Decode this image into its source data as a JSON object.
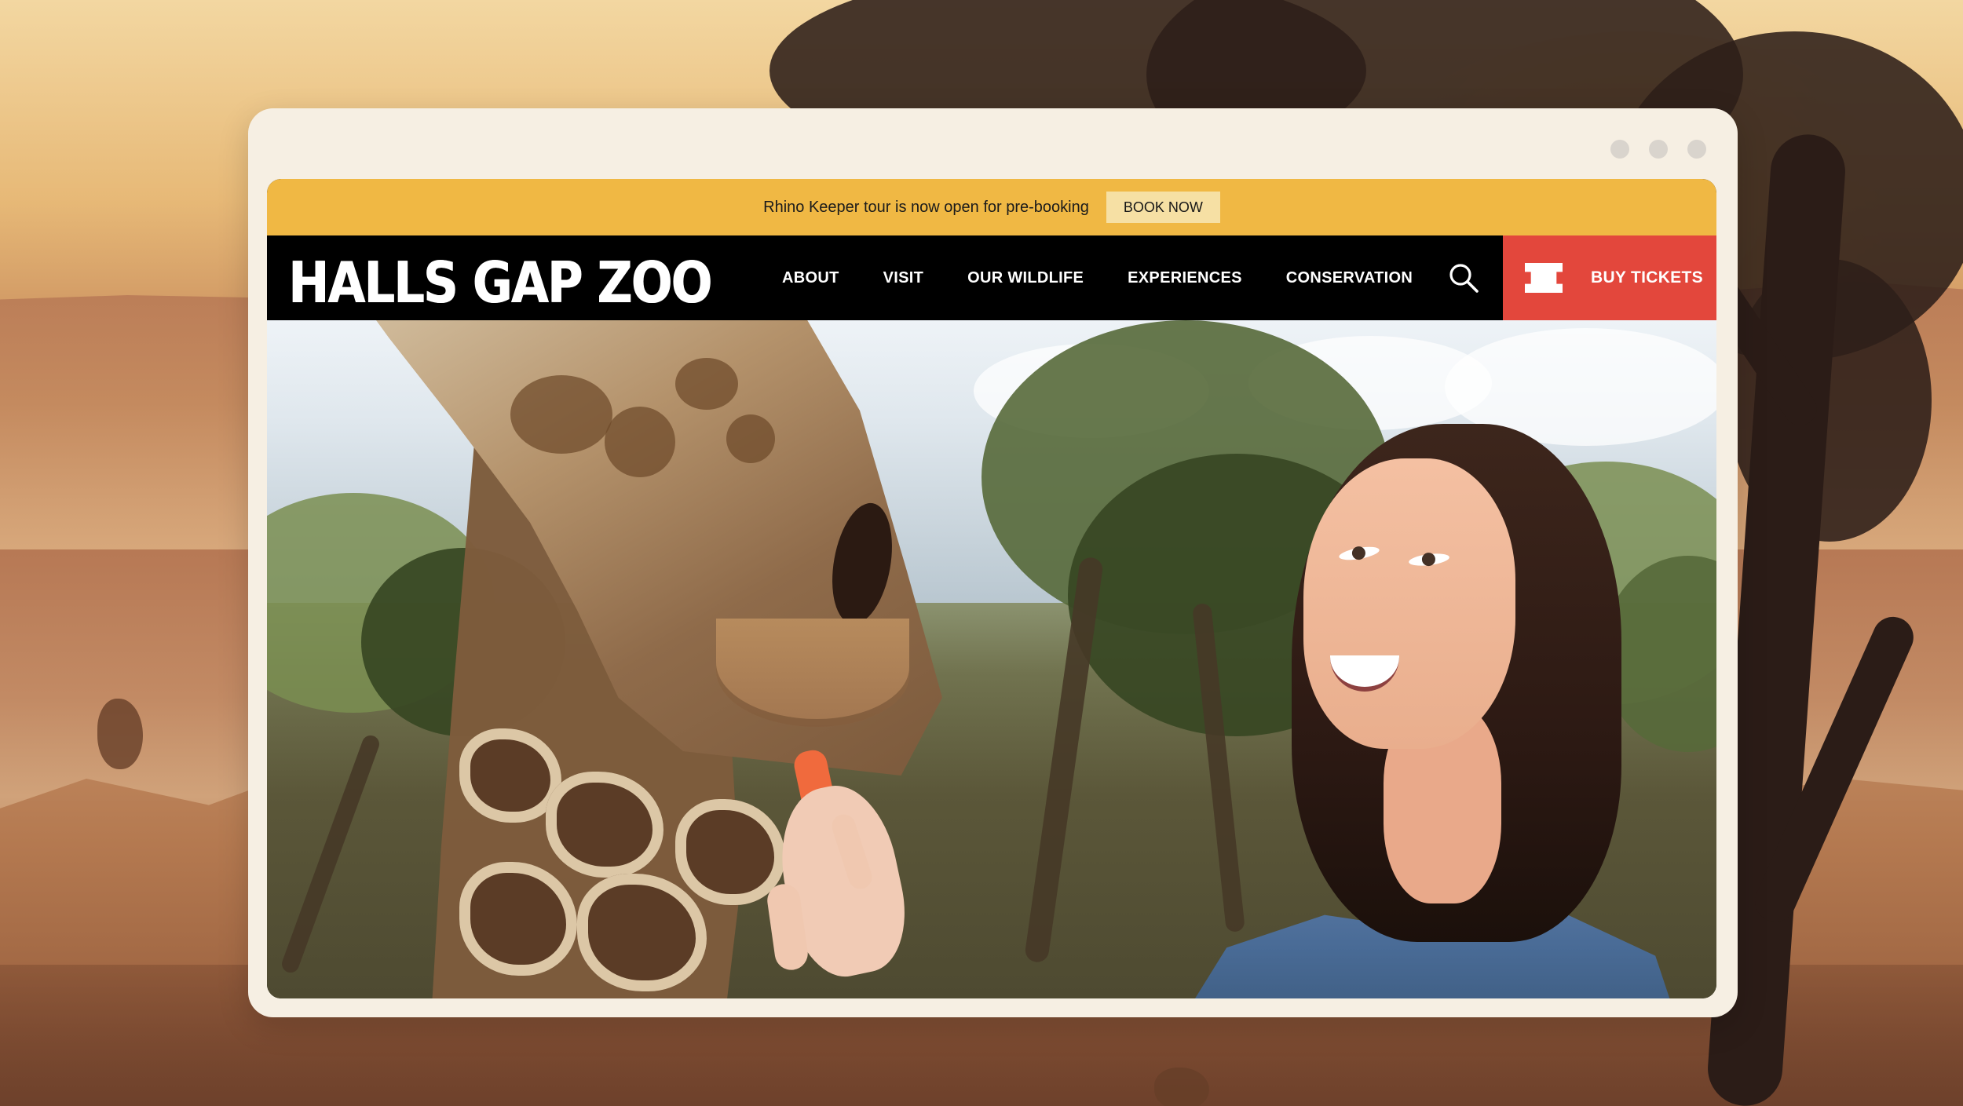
{
  "announcement": {
    "text": "Rhino Keeper tour is now open for pre-booking",
    "button": "BOOK NOW"
  },
  "brand": {
    "name": "HALLS GAP ZOO"
  },
  "navigation": {
    "items": [
      {
        "label": "ABOUT"
      },
      {
        "label": "VISIT"
      },
      {
        "label": "OUR WILDLIFE"
      },
      {
        "label": "EXPERIENCES"
      },
      {
        "label": "CONSERVATION"
      }
    ],
    "search_icon": "search-icon",
    "ticket_icon": "ticket-icon",
    "tickets_label": "BUY TICKETS"
  },
  "colors": {
    "announcement_bar": "#F0B844",
    "navbar": "#000000",
    "tickets_button": "#E3473C",
    "browser_frame": "#F6EFE3"
  },
  "hero": {
    "image": "woman feeding a giraffe"
  }
}
